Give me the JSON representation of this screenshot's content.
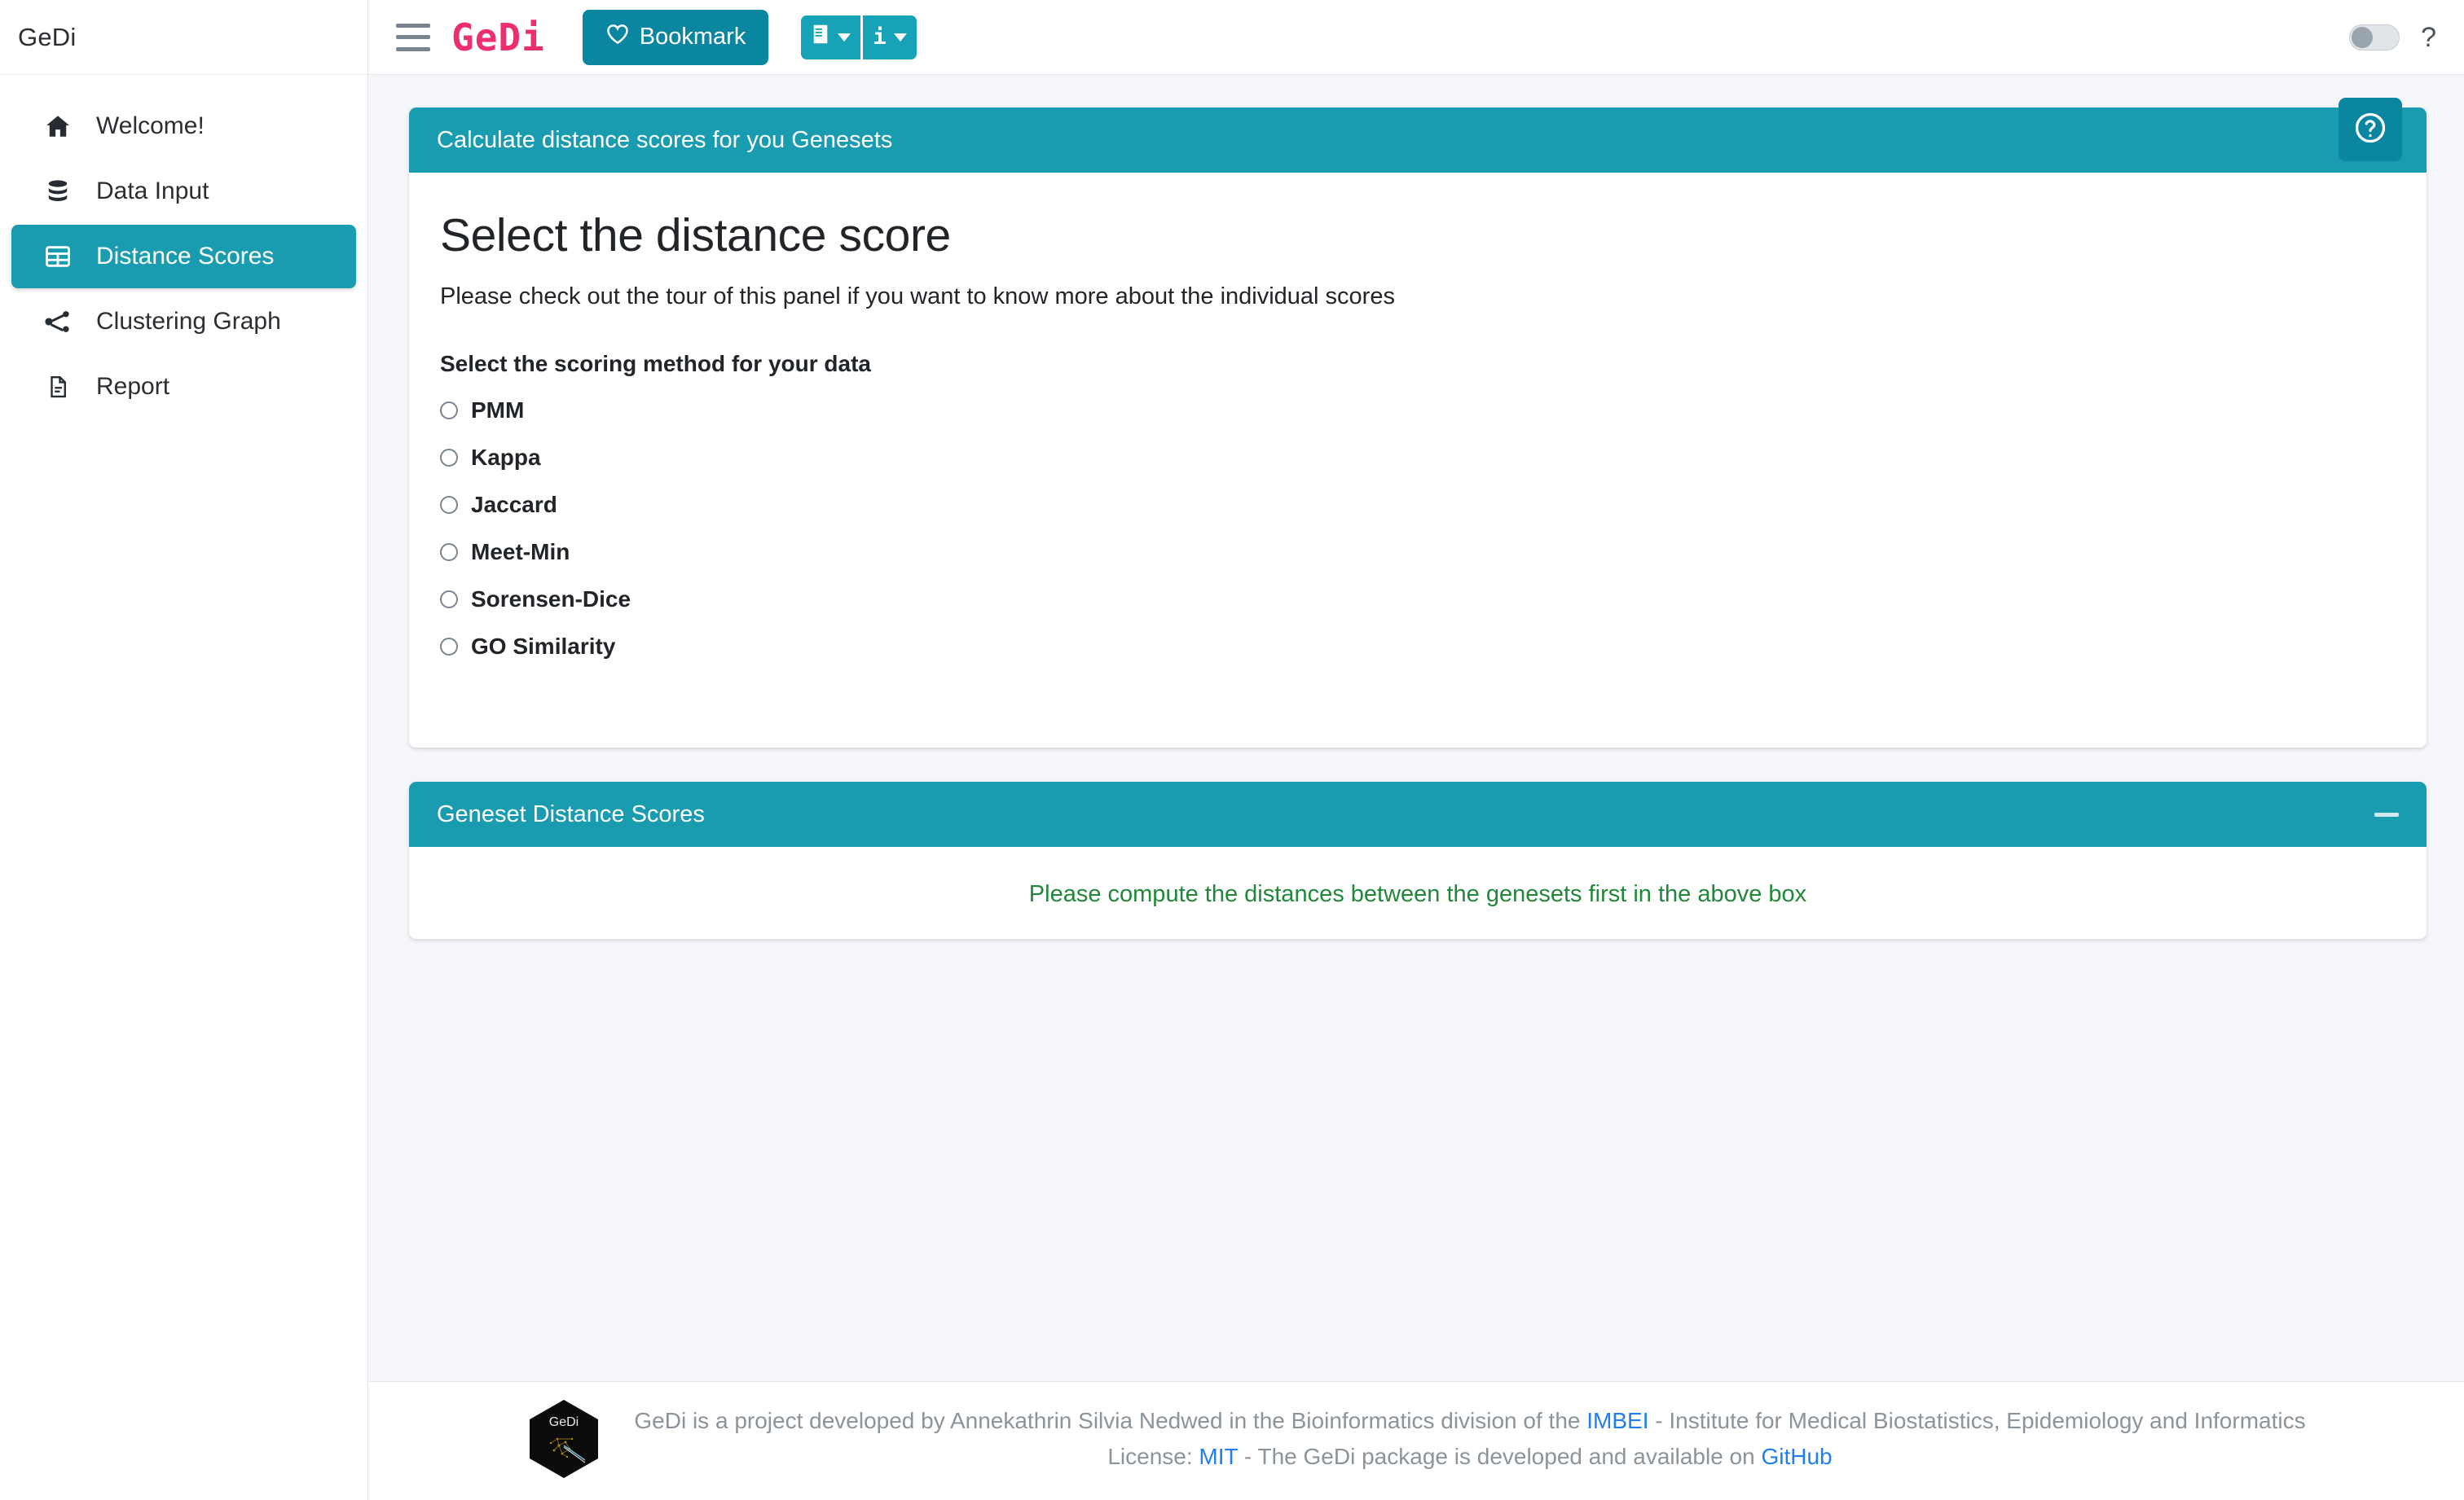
{
  "sidebar": {
    "brand": "GeDi",
    "items": [
      {
        "label": "Welcome!",
        "icon": "home-icon",
        "active": false
      },
      {
        "label": "Data Input",
        "icon": "database-icon",
        "active": false
      },
      {
        "label": "Distance Scores",
        "icon": "table-icon",
        "active": true
      },
      {
        "label": "Clustering Graph",
        "icon": "share-icon",
        "active": false
      },
      {
        "label": "Report",
        "icon": "document-icon",
        "active": false
      }
    ]
  },
  "navbar": {
    "menu_toggle_icon": "hamburger-icon",
    "brand": "GeDi",
    "bookmark_label": "Bookmark",
    "bookmark_icon": "heart-icon",
    "book_dropdown_icon": "book-icon",
    "info_dropdown_icon": "info-icon",
    "dark_mode_toggle": "off",
    "help_label": "?"
  },
  "content": {
    "tour_button_icon": "question-circle-icon",
    "panel_one": {
      "header": "Calculate distance scores for you Genesets",
      "collapse_icon": "minus-icon",
      "title": "Select the distance score",
      "subtitle": "Please check out the tour of this panel if you want to know more about the individual scores",
      "field_label": "Select the scoring method for your data",
      "options": [
        {
          "label": "PMM",
          "selected": false
        },
        {
          "label": "Kappa",
          "selected": false
        },
        {
          "label": "Jaccard",
          "selected": false
        },
        {
          "label": "Meet-Min",
          "selected": false
        },
        {
          "label": "Sorensen-Dice",
          "selected": false
        },
        {
          "label": "GO Similarity",
          "selected": false
        }
      ]
    },
    "panel_two": {
      "header": "Geneset Distance Scores",
      "collapse_icon": "minus-icon",
      "message": "Please compute the distances between the genesets first in the above box"
    }
  },
  "footer": {
    "logo_text": "GeDi",
    "line1_part1": "GeDi is a project developed by Annekathrin Silvia Nedwed in the Bioinformatics division of the ",
    "line1_link": "IMBEI",
    "line1_part2": " - Institute for Medical Biostatistics, Epidemiology and Informatics",
    "line2_part1": "License: ",
    "line2_link1": "MIT",
    "line2_part2": " - The GeDi package is developed and available on ",
    "line2_link2": "GitHub"
  },
  "colors": {
    "teal": "#1a9cb0",
    "teal_dark": "#0b86a0",
    "pink": "#ec2f72",
    "green": "#218739",
    "link_blue": "#1f7fed",
    "page_bg": "#f4f6f9"
  }
}
